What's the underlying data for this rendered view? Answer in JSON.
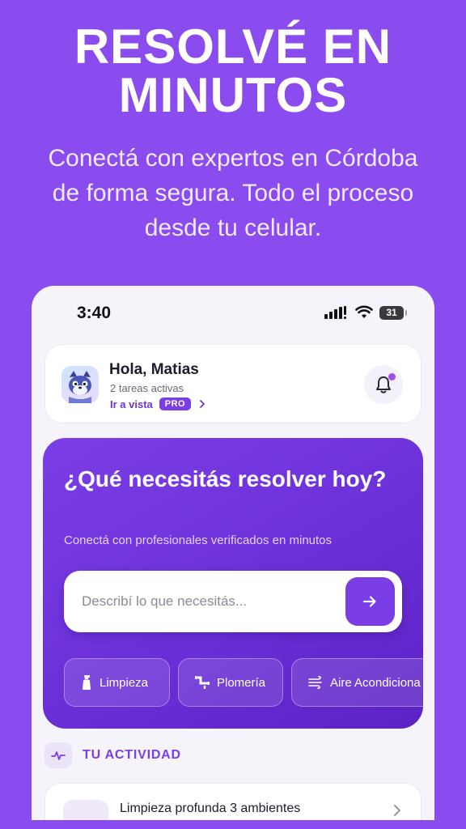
{
  "promo": {
    "title_line1": "RESOLVÉ EN",
    "title_line2": "MINUTOS",
    "subtitle": "Conectá con expertos en Córdoba de forma segura. Todo el proceso desde tu celular."
  },
  "status_bar": {
    "time": "3:40",
    "battery": "31"
  },
  "user_card": {
    "greeting": "Hola, Matias",
    "tasks": "2 tareas activas",
    "goto_label": "Ir a vista",
    "badge": "PRO"
  },
  "hero": {
    "title": "¿Qué necesitás resolver hoy?",
    "subtitle": "Conectá con profesionales verificados en minutos",
    "search_placeholder": "Describí lo que necesitás...",
    "search_value": ""
  },
  "categories": [
    {
      "label": "Limpieza",
      "icon": "spray-bottle-icon"
    },
    {
      "label": "Plomería",
      "icon": "pipe-icon"
    },
    {
      "label": "Aire Acondiciona",
      "icon": "wind-icon"
    }
  ],
  "activity": {
    "title": "TU ACTIVIDAD",
    "items": [
      {
        "name": "Limpieza profunda 3 ambientes"
      }
    ]
  },
  "colors": {
    "background": "#8a4bef",
    "accent": "#7a3de6",
    "hero_gradient_start": "#7c3ee6",
    "hero_gradient_end": "#5b22c4"
  }
}
